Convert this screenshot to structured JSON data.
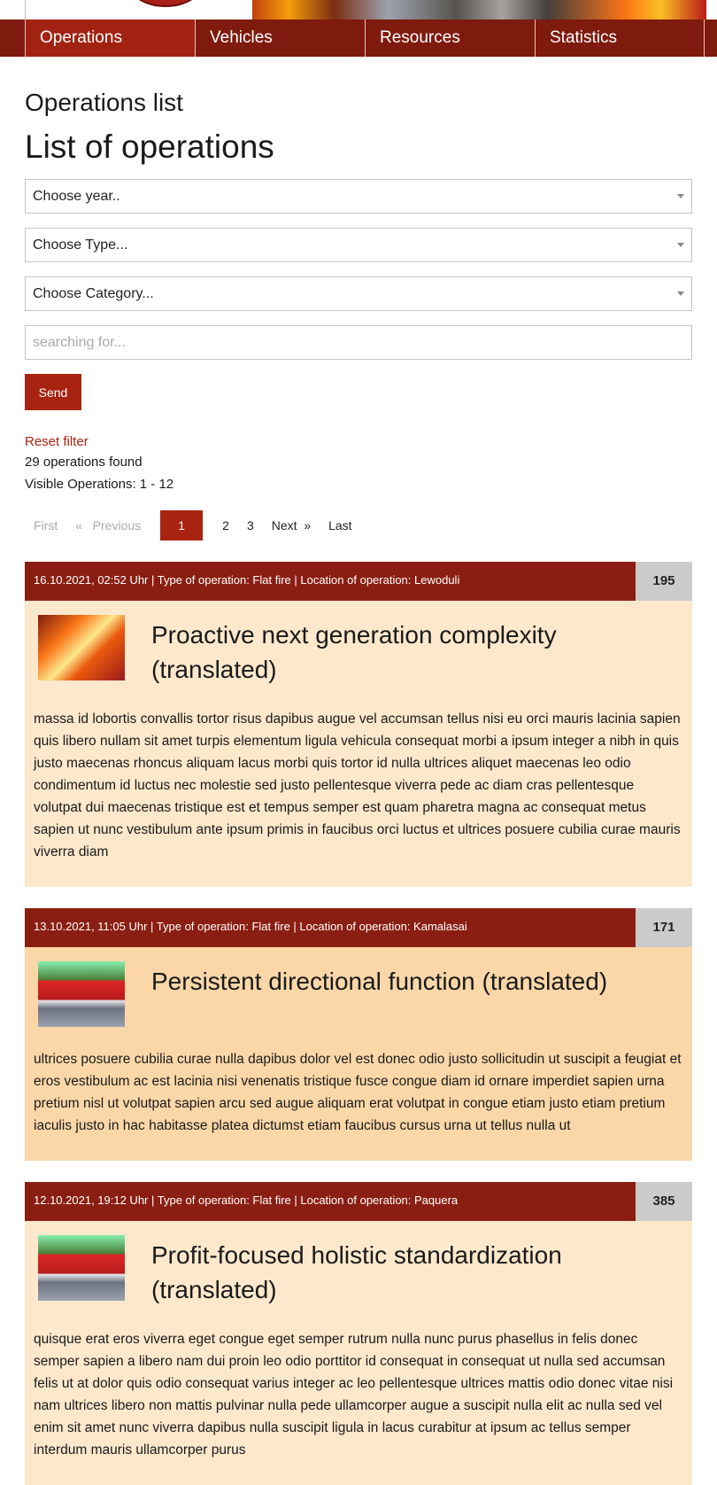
{
  "nav": {
    "items": [
      "Operations",
      "Vehicles",
      "Resources",
      "Statistics"
    ]
  },
  "page": {
    "title": "Operations list",
    "list_title": "List of operations"
  },
  "filters": {
    "year": "Choose year..",
    "type": "Choose Type...",
    "category": "Choose Category...",
    "search_placeholder": "searching for...",
    "send_label": "Send",
    "reset_label": "Reset filter"
  },
  "results": {
    "found": "29 operations found",
    "visible": "Visible Operations: 1 - 12"
  },
  "pagination": {
    "first": "First",
    "previous": "«   Previous",
    "pages": [
      "1",
      "2",
      "3"
    ],
    "current": "1",
    "next": "Next  »",
    "last": "Last"
  },
  "operations": [
    {
      "meta": "16.10.2021, 02:52 Uhr | Type of operation: Flat fire | Location of operation: Lewoduli",
      "count": "195",
      "title": "Proactive next generation complexity (translated)",
      "thumb": "burning-car-photo",
      "text": "massa id lobortis convallis tortor risus dapibus augue vel accumsan tellus nisi eu orci mauris lacinia sapien quis libero nullam sit amet turpis elementum ligula vehicula consequat morbi a ipsum integer a nibh in quis justo maecenas rhoncus aliquam lacus morbi quis tortor id nulla ultrices aliquet maecenas leo odio condimentum id luctus nec molestie sed justo pellentesque viverra pede ac diam cras pellentesque volutpat dui maecenas tristique est et tempus semper est quam pharetra magna ac consequat metus sapien ut nunc vestibulum ante ipsum primis in faucibus orci luctus et ultrices posuere cubilia curae mauris viverra diam"
    },
    {
      "meta": "13.10.2021, 11:05 Uhr | Type of operation: Flat fire | Location of operation: Kamalasai",
      "count": "171",
      "title": "Persistent directional function (translated)",
      "thumb": "fire-truck-photo",
      "text": "ultrices posuere cubilia curae nulla dapibus dolor vel est donec odio justo sollicitudin ut suscipit a feugiat et eros vestibulum ac est lacinia nisi venenatis tristique fusce congue diam id ornare imperdiet sapien urna pretium nisl ut volutpat sapien arcu sed augue aliquam erat volutpat in congue etiam justo etiam pretium iaculis justo in hac habitasse platea dictumst etiam faucibus cursus urna ut tellus nulla ut"
    },
    {
      "meta": "12.10.2021, 19:12 Uhr | Type of operation: Flat fire | Location of operation: Paquera",
      "count": "385",
      "title": "Profit-focused holistic standardization (translated)",
      "thumb": "fire-truck-photo",
      "text": "quisque erat eros viverra eget congue eget semper rutrum nulla nunc purus phasellus in felis donec semper sapien a libero nam dui proin leo odio porttitor id consequat in consequat ut nulla sed accumsan felis ut at dolor quis odio consequat varius integer ac leo pellentesque ultrices mattis odio donec vitae nisi nam ultrices libero non mattis pulvinar nulla pede ullamcorper augue a suscipit nulla elit ac nulla sed vel enim sit amet nunc viverra dapibus nulla suscipit ligula in lacus curabitur at ipsum ac tellus semper interdum mauris ullamcorper purus"
    }
  ]
}
